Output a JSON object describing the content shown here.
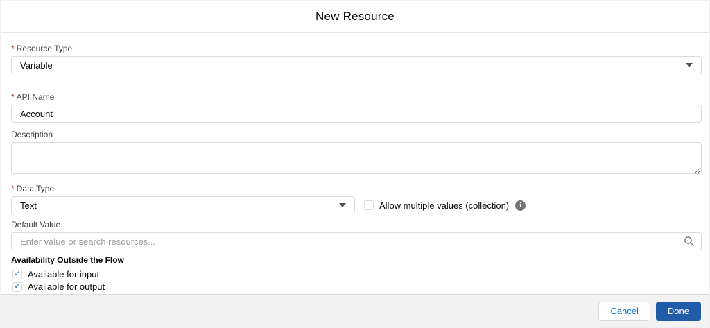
{
  "modal": {
    "title": "New Resource",
    "required_marker": "*",
    "resource_type": {
      "label": "Resource Type",
      "required": true,
      "value": "Variable"
    },
    "api_name": {
      "label": "API Name",
      "required": true,
      "value": "Account"
    },
    "description": {
      "label": "Description",
      "value": ""
    },
    "data_type": {
      "label": "Data Type",
      "required": true,
      "value": "Text"
    },
    "allow_multiple": {
      "label": "Allow multiple values (collection)",
      "checked": false
    },
    "default_value": {
      "label": "Default Value",
      "placeholder": "Enter value or search resources...",
      "value": ""
    },
    "availability": {
      "heading": "Availability Outside the Flow",
      "options": [
        {
          "label": "Available for input",
          "checked": true
        },
        {
          "label": "Available for output",
          "checked": true
        }
      ]
    },
    "footer": {
      "cancel": "Cancel",
      "done": "Done"
    }
  },
  "icons": {
    "info_glyph": "i",
    "dropdown": "caret-down",
    "search": "magnifier",
    "check": "checkmark"
  },
  "colors": {
    "accent_blue": "#0070d2",
    "done_button_bg": "#215ca8",
    "required_red": "#c23934",
    "footer_bg": "#f3f2f2",
    "input_border": "#dddbda",
    "label_text": "#3e3e3c",
    "title_text": "#080707"
  }
}
